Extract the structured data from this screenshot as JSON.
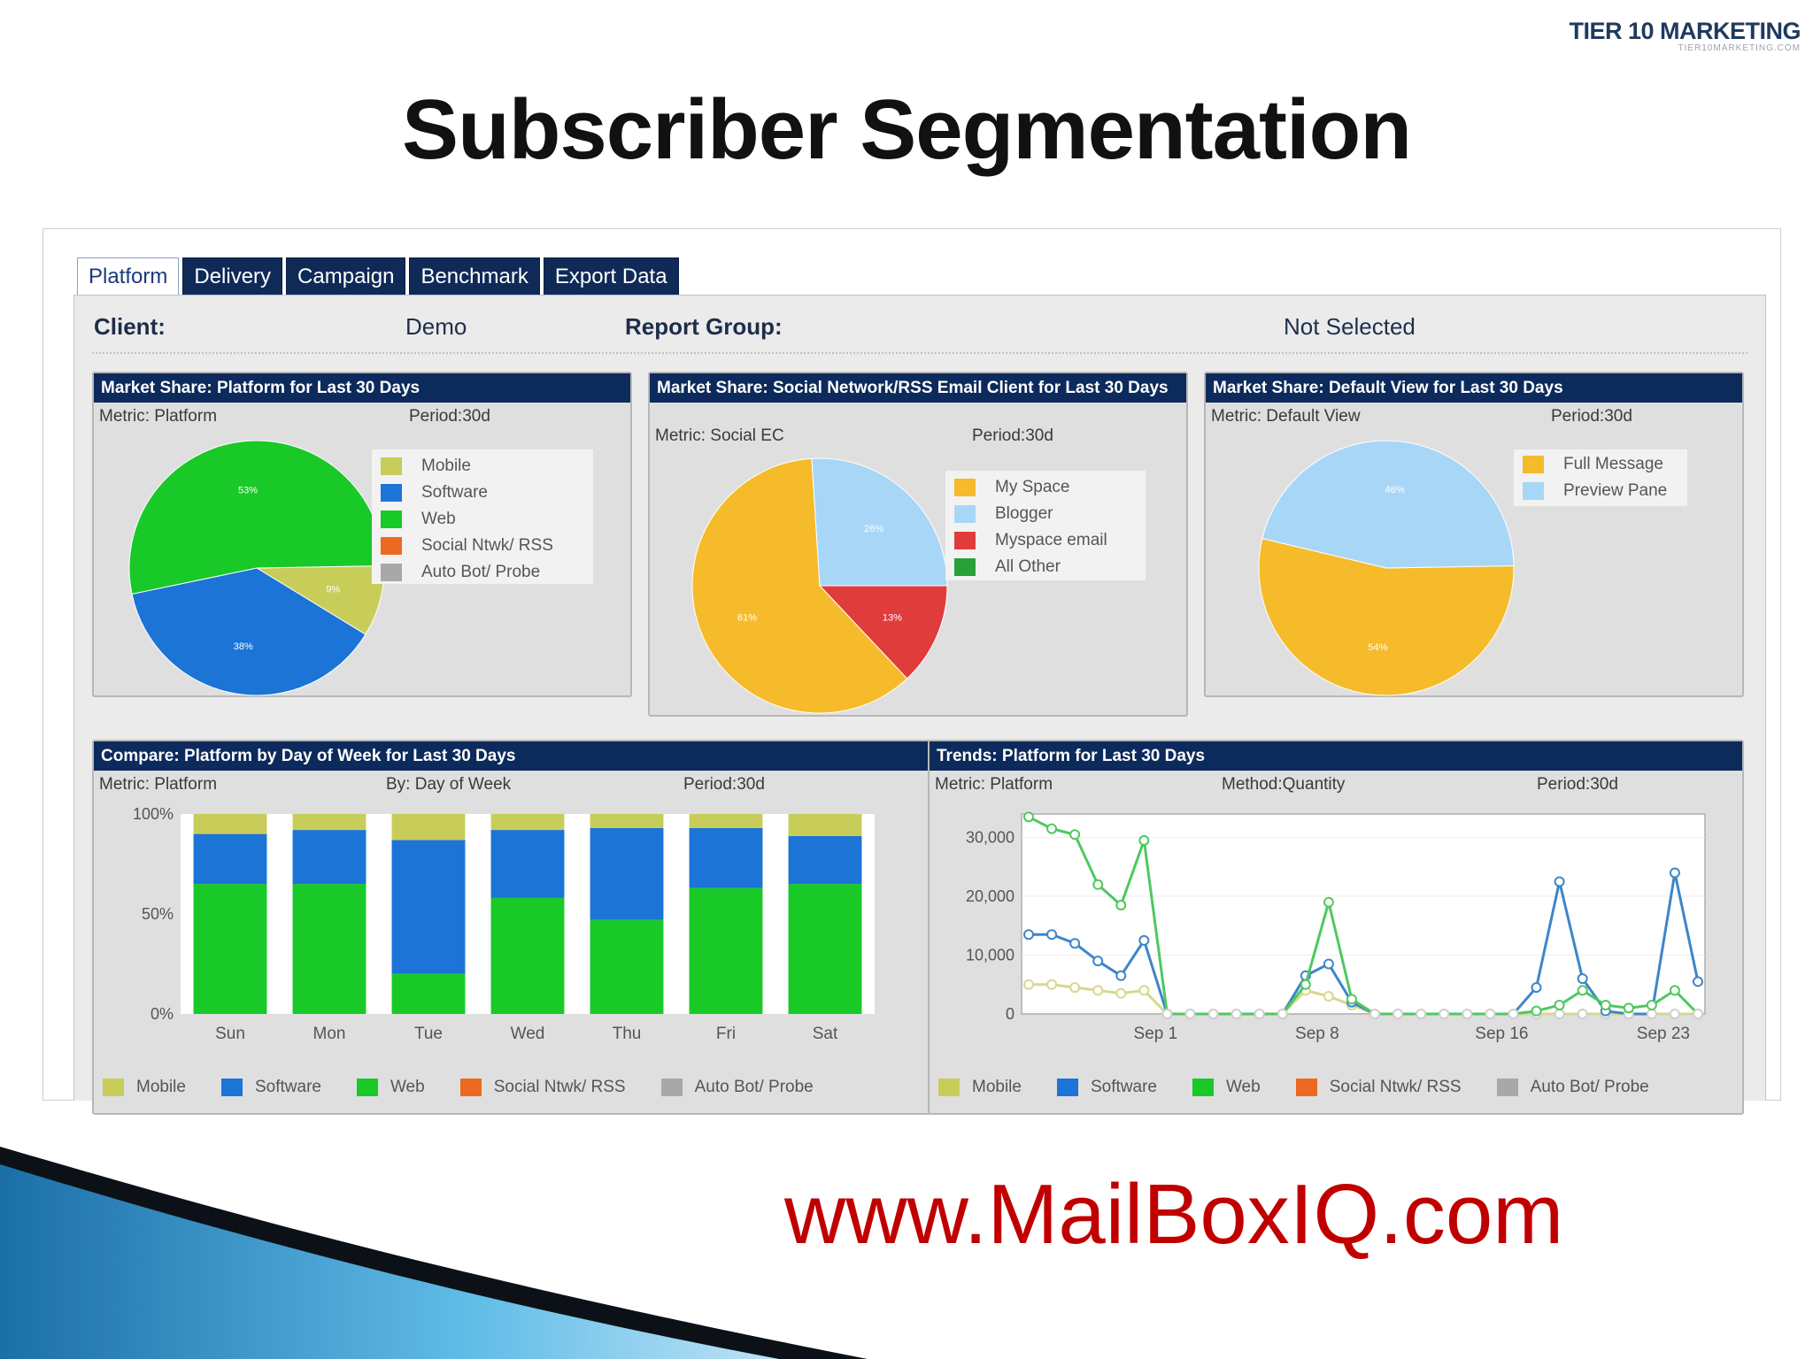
{
  "brand": {
    "name": "TIER 10 MARKETING",
    "sub": "TIER10MARKETING.COM"
  },
  "slide_title": "Subscriber Segmentation",
  "tabs": [
    "Platform",
    "Delivery",
    "Campaign",
    "Benchmark",
    "Export Data"
  ],
  "header": {
    "client_label": "Client:",
    "client_value": "Demo",
    "group_label": "Report Group:",
    "group_value": "Not Selected"
  },
  "colors": {
    "mobile": "#c8cd5a",
    "software": "#1b74d6",
    "web": "#18c928",
    "social": "#ec6a1f",
    "bot": "#a8a8a8",
    "myspace": "#f6bb2b",
    "blogger": "#a8d6f7",
    "myspace_email": "#e03c3c",
    "all_other": "#2aa03a",
    "full_message": "#f6bb2b",
    "preview_pane": "#a8d6f7",
    "navy": "#0d2a5c"
  },
  "panels": {
    "platform": {
      "title": "Market Share: Platform for Last 30 Days",
      "metric": "Metric: Platform",
      "period": "Period:30d"
    },
    "social": {
      "title": "Market Share: Social Network/RSS Email Client for Last 30 Days",
      "metric": "Metric: Social EC",
      "period": "Period:30d"
    },
    "default": {
      "title": "Market Share: Default View for Last 30 Days",
      "metric": "Metric: Default View",
      "period": "Period:30d"
    },
    "compare": {
      "title": "Compare: Platform by Day of Week for Last 30 Days",
      "metric": "Metric: Platform",
      "by": "By: Day of Week",
      "period": "Period:30d"
    },
    "trends": {
      "title": "Trends: Platform for Last 30 Days",
      "metric": "Metric: Platform",
      "method": "Method:Quantity",
      "period": "Period:30d"
    }
  },
  "legend_platform": [
    "Mobile",
    "Software",
    "Web",
    "Social Ntwk/ RSS",
    "Auto Bot/ Probe"
  ],
  "legend_social": [
    "My Space",
    "Blogger",
    "Myspace email",
    "All Other"
  ],
  "legend_default": [
    "Full Message",
    "Preview Pane"
  ],
  "url": "www.MailBoxIQ.com",
  "chart_data": [
    {
      "type": "pie",
      "labels": [
        "Mobile",
        "Software",
        "Web",
        "Social Ntwk/ RSS",
        "Auto Bot/ Probe"
      ],
      "values": [
        9,
        38,
        53,
        0,
        0
      ],
      "slice_labels": [
        "9%",
        "38%",
        "53%"
      ]
    },
    {
      "type": "pie",
      "labels": [
        "My Space",
        "Blogger",
        "Myspace email",
        "All Other"
      ],
      "values": [
        61,
        26,
        13,
        0
      ],
      "slice_labels": [
        "61%",
        "26%",
        "13%"
      ]
    },
    {
      "type": "pie",
      "labels": [
        "Full Message",
        "Preview Pane"
      ],
      "values": [
        54,
        46
      ],
      "slice_labels": [
        "54%",
        "46%"
      ]
    },
    {
      "type": "bar",
      "stacked": "percent",
      "categories": [
        "Sun",
        "Mon",
        "Tue",
        "Wed",
        "Thu",
        "Fri",
        "Sat"
      ],
      "ytick_labels": [
        "100%",
        "50%",
        "0%"
      ],
      "series": [
        {
          "name": "Web",
          "values": [
            65,
            65,
            20,
            58,
            47,
            63,
            65
          ]
        },
        {
          "name": "Software",
          "values": [
            25,
            27,
            67,
            34,
            46,
            30,
            24
          ]
        },
        {
          "name": "Mobile",
          "values": [
            10,
            8,
            13,
            8,
            7,
            7,
            11
          ]
        },
        {
          "name": "Social Ntwk/ RSS",
          "values": [
            0,
            0,
            0,
            0,
            0,
            0,
            0
          ]
        },
        {
          "name": "Auto Bot/ Probe",
          "values": [
            0,
            0,
            0,
            0,
            0,
            0,
            0
          ]
        }
      ],
      "legend": [
        "Mobile",
        "Software",
        "Web",
        "Social Ntwk/ RSS",
        "Auto Bot/ Probe"
      ]
    },
    {
      "type": "line",
      "x": [
        1,
        2,
        3,
        4,
        5,
        6,
        7,
        8,
        9,
        10,
        11,
        12,
        13,
        14,
        15,
        16,
        17,
        18,
        19,
        20,
        21,
        22,
        23,
        24,
        25,
        26,
        27,
        28,
        29,
        30
      ],
      "xtick_labels": [
        "Sep 1",
        "Sep 8",
        "Sep 16",
        "Sep 23"
      ],
      "xtick_positions": [
        6.5,
        13.5,
        21.5,
        28.5
      ],
      "ytick_labels": [
        "30,000",
        "20,000",
        "10,000",
        "0"
      ],
      "ylim": [
        0,
        34000
      ],
      "series": [
        {
          "name": "Web",
          "values": [
            33500,
            31500,
            30500,
            22000,
            18500,
            29500,
            0,
            0,
            0,
            0,
            0,
            0,
            5000,
            19000,
            2500,
            0,
            0,
            0,
            0,
            0,
            0,
            0,
            500,
            1500,
            4000,
            1500,
            1000,
            1500,
            4000,
            0
          ]
        },
        {
          "name": "Software",
          "values": [
            13500,
            13500,
            12000,
            9000,
            6500,
            12500,
            0,
            0,
            0,
            0,
            0,
            0,
            6500,
            8500,
            2000,
            0,
            0,
            0,
            0,
            0,
            0,
            0,
            4500,
            22500,
            6000,
            500,
            0,
            0,
            24000,
            5500
          ]
        },
        {
          "name": "Mobile",
          "values": [
            5000,
            5000,
            4500,
            4000,
            3500,
            4000,
            0,
            0,
            0,
            0,
            0,
            0,
            4000,
            3000,
            1500,
            0,
            0,
            0,
            0,
            0,
            0,
            0,
            0,
            0,
            0,
            0,
            0,
            0,
            0,
            0
          ]
        }
      ],
      "legend": [
        "Mobile",
        "Software",
        "Web",
        "Social Ntwk/ RSS",
        "Auto Bot/ Probe"
      ]
    }
  ]
}
